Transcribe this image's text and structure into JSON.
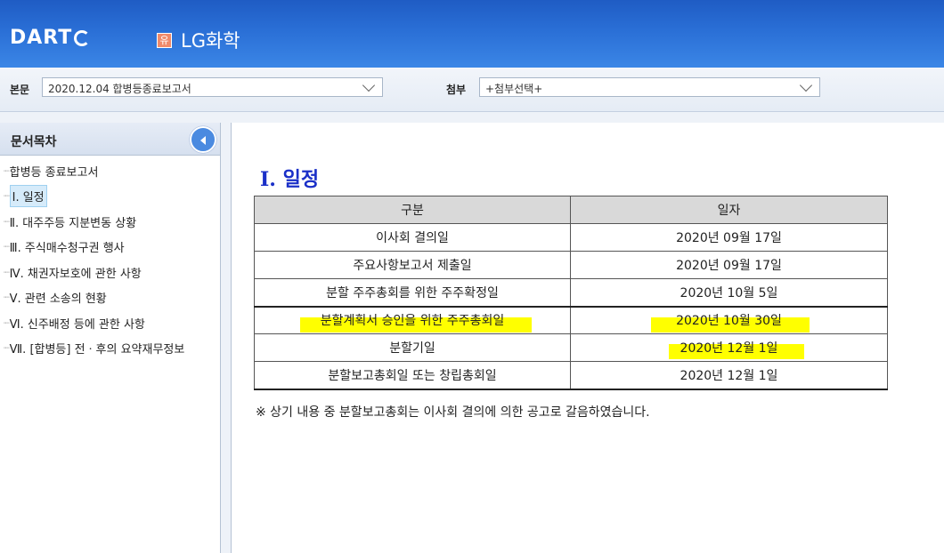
{
  "header": {
    "logo": "DART",
    "badge": "유",
    "company": "LG화학"
  },
  "selectors": {
    "main_label": "본문",
    "main_value": "2020.12.04  합병등종료보고서",
    "attach_label": "첨부",
    "attach_value": "+첨부선택+"
  },
  "sidebar": {
    "title": "문서목차",
    "items": [
      {
        "label": "합병등 종료보고서",
        "selected": false
      },
      {
        "label": "Ⅰ. 일정",
        "selected": true
      },
      {
        "label": "Ⅱ. 대주주등 지분변동 상황",
        "selected": false
      },
      {
        "label": "Ⅲ. 주식매수청구권 행사",
        "selected": false
      },
      {
        "label": "Ⅳ. 채권자보호에 관한 사항",
        "selected": false
      },
      {
        "label": "Ⅴ. 관련 소송의 현황",
        "selected": false
      },
      {
        "label": "Ⅵ. 신주배정 등에 관한 사항",
        "selected": false
      },
      {
        "label": "Ⅶ. [합병등] 전ㆍ후의 요약재무정보",
        "selected": false
      }
    ]
  },
  "content": {
    "section_title": "Ⅰ. 일정",
    "table": {
      "headers": [
        "구분",
        "일자"
      ],
      "rows": [
        [
          "이사회 결의일",
          "2020년 09월 17일"
        ],
        [
          "주요사항보고서 제출일",
          "2020년 09월 17일"
        ],
        [
          "분할 주주총회를 위한 주주확정일",
          "2020년 10월 5일"
        ],
        [
          "분할계획서 승인을 위한 주주총회일",
          "2020년 10월 30일"
        ],
        [
          "분할기일",
          "2020년 12월 1일"
        ],
        [
          "분할보고총회일 또는 창립총회일",
          "2020년 12월 1일"
        ]
      ]
    },
    "note": "※ 상기 내용 중 분할보고총회는 이사회 결의에 의한 공고로 갈음하였습니다.",
    "highlight_color": "#ffff00"
  }
}
